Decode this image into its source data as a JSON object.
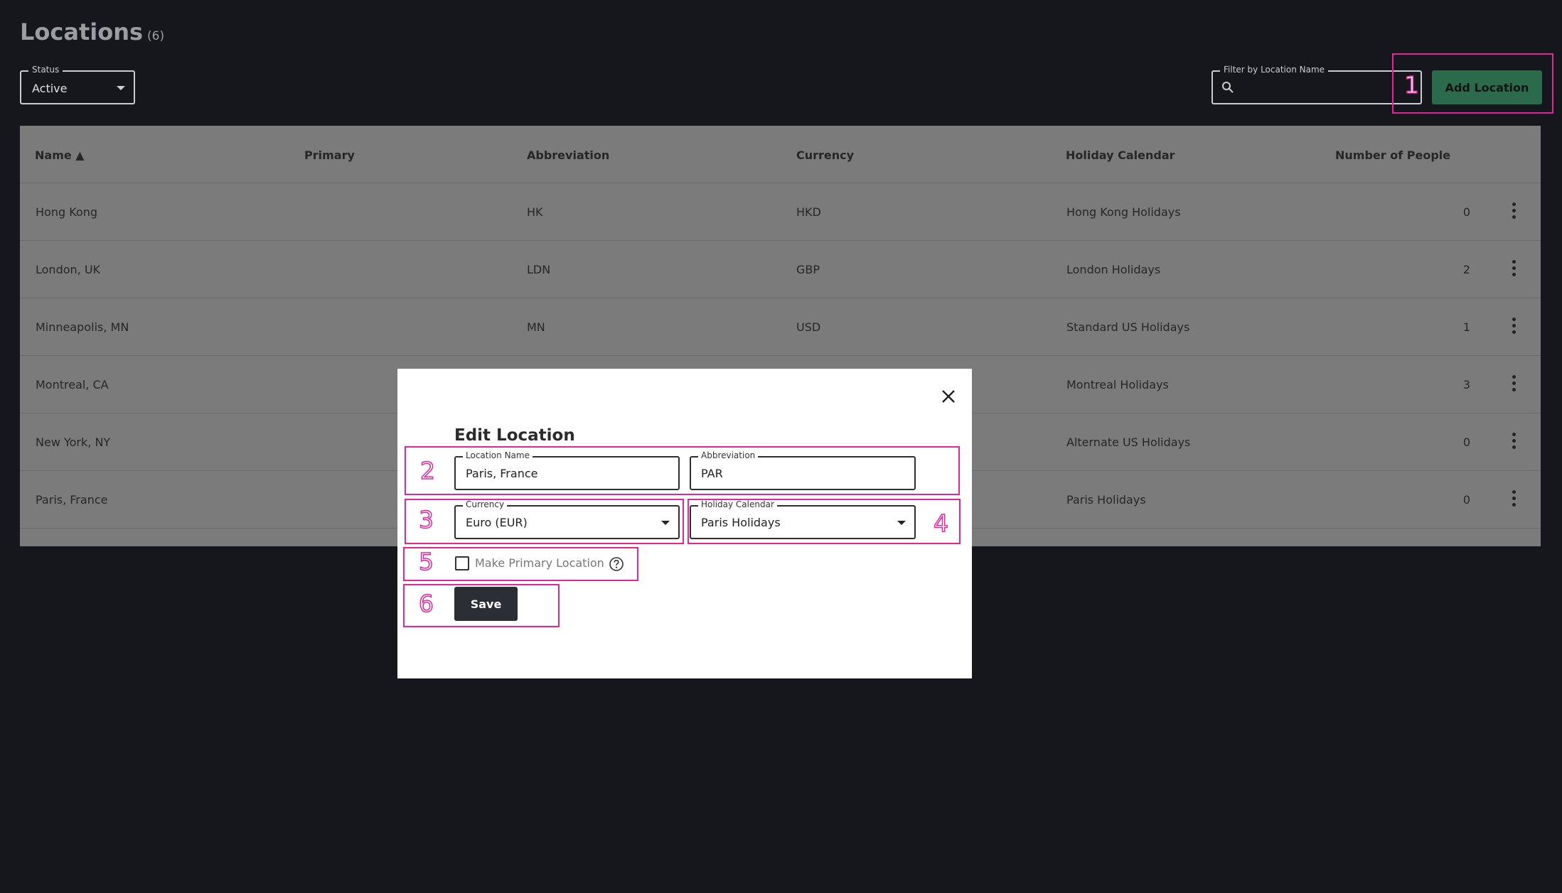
{
  "page": {
    "title": "Locations",
    "count": "(6)"
  },
  "status_filter": {
    "label": "Status",
    "value": "Active"
  },
  "name_filter": {
    "label": "Filter by Location Name",
    "value": ""
  },
  "add_button": "Add Location",
  "table": {
    "headers": [
      "Name",
      "Primary",
      "Abbreviation",
      "Currency",
      "Holiday Calendar",
      "Number of People"
    ],
    "sort_indicator": "▲",
    "rows": [
      {
        "name": "Hong Kong",
        "primary": "",
        "abbr": "HK",
        "currency": "HKD",
        "calendar": "Hong Kong Holidays",
        "people": "0"
      },
      {
        "name": "London, UK",
        "primary": "",
        "abbr": "LDN",
        "currency": "GBP",
        "calendar": "London Holidays",
        "people": "2"
      },
      {
        "name": "Minneapolis, MN",
        "primary": "",
        "abbr": "MN",
        "currency": "USD",
        "calendar": "Standard US Holidays",
        "people": "1"
      },
      {
        "name": "Montreal, CA",
        "primary": "",
        "abbr": "",
        "currency": "",
        "calendar": "Montreal Holidays",
        "people": "3"
      },
      {
        "name": "New York, NY",
        "primary": "",
        "abbr": "",
        "currency": "",
        "calendar": "Alternate US Holidays",
        "people": "0"
      },
      {
        "name": "Paris, France",
        "primary": "",
        "abbr": "",
        "currency": "",
        "calendar": "Paris Holidays",
        "people": "0"
      }
    ]
  },
  "modal": {
    "title": "Edit Location",
    "location_name": {
      "label": "Location Name",
      "value": "Paris, France"
    },
    "abbreviation": {
      "label": "Abbreviation",
      "value": "PAR"
    },
    "currency": {
      "label": "Currency",
      "value": "Euro (EUR)"
    },
    "holiday_calendar": {
      "label": "Holiday Calendar",
      "value": "Paris Holidays"
    },
    "primary_checkbox_label": "Make Primary Location",
    "primary_checked": false,
    "save_label": "Save"
  },
  "annotations": [
    "1",
    "2",
    "3",
    "4",
    "5",
    "6"
  ],
  "colors": {
    "highlight": "#e0289a",
    "add_button": "#2b6b4b",
    "save_button": "#2b2e35",
    "table_bg": "#7b7b7b"
  }
}
